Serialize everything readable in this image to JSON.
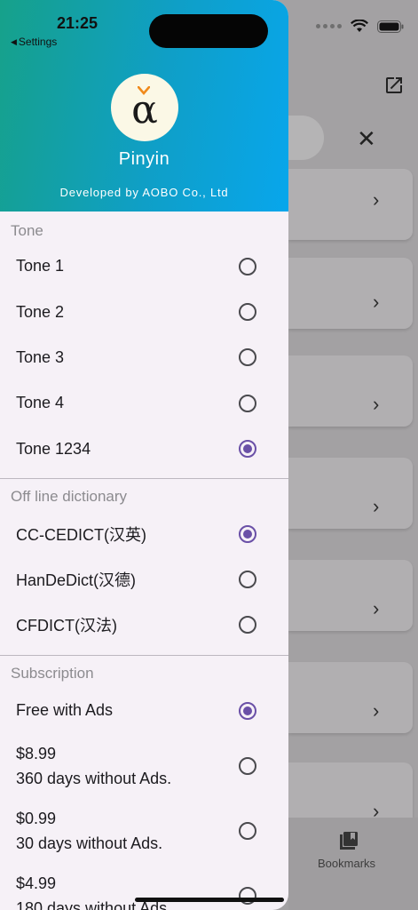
{
  "status": {
    "time": "21:25",
    "back_label": "Settings"
  },
  "header": {
    "logo_glyph": "α",
    "app_name": "Pinyin",
    "developer": "Developed by AOBO Co., Ltd"
  },
  "sections": {
    "tone": {
      "title": "Tone",
      "options": [
        {
          "label": "Tone 1",
          "selected": false
        },
        {
          "label": "Tone 2",
          "selected": false
        },
        {
          "label": "Tone 3",
          "selected": false
        },
        {
          "label": "Tone 4",
          "selected": false
        },
        {
          "label": "Tone 1234",
          "selected": true
        }
      ]
    },
    "dictionary": {
      "title": "Off line dictionary",
      "options": [
        {
          "label": "CC-CEDICT(汉英)",
          "selected": true
        },
        {
          "label": "HanDeDict(汉德)",
          "selected": false
        },
        {
          "label": "CFDICT(汉法)",
          "selected": false
        }
      ]
    },
    "subscription": {
      "title": "Subscription",
      "options": [
        {
          "label": "Free with Ads",
          "selected": true
        },
        {
          "price": "$8.99",
          "desc": "360 days without Ads.",
          "selected": false
        },
        {
          "price": "$0.99",
          "desc": "30 days without Ads.",
          "selected": false
        },
        {
          "price": "$4.99",
          "desc": "180 days without Ads",
          "selected": false
        }
      ]
    }
  },
  "background": {
    "bookmarks_label": "Bookmarks"
  },
  "colors": {
    "accent": "#6a50a7",
    "header_start": "#16a18a",
    "header_end": "#08a6ec"
  },
  "icons": [
    "wifi-icon",
    "battery-icon",
    "external-link-icon",
    "close-icon",
    "chevron-right-icon",
    "bookmarks-icon",
    "radio-icon"
  ]
}
